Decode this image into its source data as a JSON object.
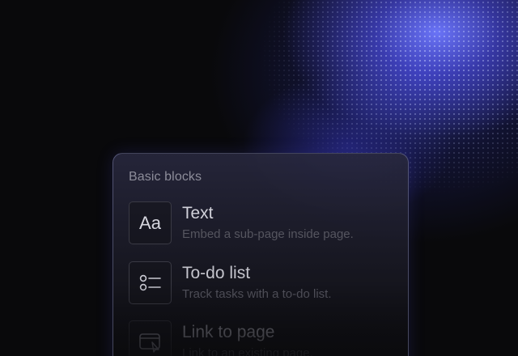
{
  "menu": {
    "title": "Basic blocks",
    "items": [
      {
        "label": "Text",
        "description": "Embed a sub-page inside page.",
        "icon": "text-aa-icon",
        "icon_text": "Aa"
      },
      {
        "label": "To-do list",
        "description": "Track tasks with a to-do list.",
        "icon": "todo-list-icon"
      },
      {
        "label": "Link to page",
        "description": "Link to an existing page.",
        "icon": "link-page-icon"
      }
    ]
  },
  "colors": {
    "accent": "#5a5cf5",
    "background": "#09090b"
  }
}
